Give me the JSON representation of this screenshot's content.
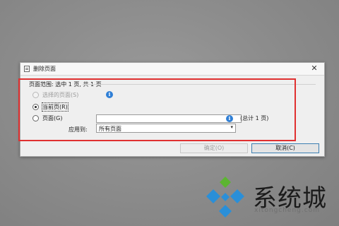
{
  "dialog": {
    "title": "删除页面",
    "close_label": "✕",
    "group_label": "页面范围: 选中 1 页, 共 1 页",
    "options": {
      "selected": "选择的页面(S)",
      "current": "当前页(R)",
      "pages": "页面(G)"
    },
    "info_glyph": "i",
    "page_input_value": "",
    "total_text": "(总计 1 页)",
    "apply_label": "应用到:",
    "apply_value": "所有页面",
    "ok_label": "确定(O)",
    "cancel_label": "取消(C)"
  },
  "watermark": {
    "text": "系统城",
    "url": "xitongcheng.com"
  },
  "colors": {
    "highlight_frame": "#e03030",
    "info_icon": "#2f7fd6",
    "logo_green": "#5cb531",
    "logo_blue": "#2a8fd8"
  }
}
